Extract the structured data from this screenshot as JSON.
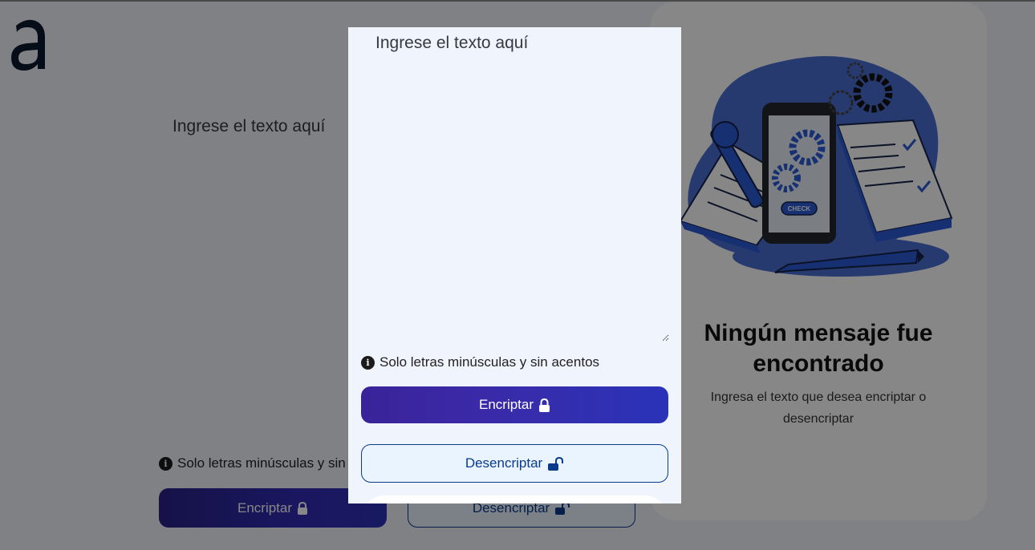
{
  "input": {
    "placeholder": "Ingrese el texto aquí"
  },
  "hint": {
    "text": "Solo letras minúsculas y sin acentos",
    "text_truncated": "Solo letras minúsculas y sin"
  },
  "buttons": {
    "encrypt_label": "Encriptar",
    "decrypt_label": "Desencriptar"
  },
  "result": {
    "title": "Ningún mensaje fue encontrado",
    "subtitle": "Ingresa el texto que desea encriptar o desencriptar"
  },
  "illustration": {
    "screen_button": "CHECK"
  },
  "icons": {
    "logo": "alura-a-logo",
    "info": "info-circle-icon",
    "lock": "lock-icon",
    "unlock": "unlock-icon"
  },
  "colors": {
    "accent": "#2f2ea8",
    "accent_dark": "#0a3a8c",
    "background": "#f0f4fc",
    "overlay": "rgba(0,0,0,0.47)"
  }
}
